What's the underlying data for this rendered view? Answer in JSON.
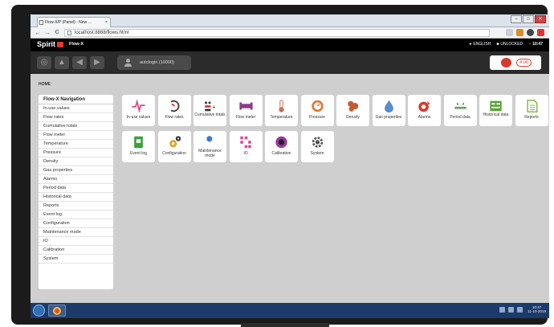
{
  "browser": {
    "tab_title": "Flow-X/P (Panel) - New …",
    "tab_close": "×",
    "url": "localhost:8888/flows.html",
    "window_controls": [
      "–",
      "□",
      "✕"
    ],
    "nav": {
      "back": "←",
      "forward": "→",
      "reload": "C"
    },
    "toolbar_icons": [
      "bookmark-star-icon",
      "extension-icon",
      "chrome-icon",
      "settings-menu-icon"
    ]
  },
  "app": {
    "logo": "Spirit",
    "name": "Flow-X",
    "status": [
      {
        "icon": "chat-icon",
        "glyph": "●",
        "label": "ENGLISH"
      },
      {
        "icon": "unlock-icon",
        "glyph": "■",
        "label": "UNLOCKED"
      },
      {
        "icon": "clock-icon",
        "glyph": "◔",
        "label": "10:47"
      }
    ]
  },
  "controls": {
    "buttons": [
      {
        "name": "globe-button",
        "glyph": "◎"
      },
      {
        "name": "home-button",
        "glyph": "▲"
      },
      {
        "name": "back-button",
        "glyph": "◀"
      },
      {
        "name": "forward-button",
        "glyph": "▶"
      }
    ],
    "login": "autologin (10000)",
    "alarm_count": "4 (4)"
  },
  "breadcrumb": "HOME",
  "sidebar": {
    "title": "Flow-X Navigation",
    "items": [
      "In-use values",
      "Flow rates",
      "Cumulative totals",
      "Flow meter",
      "Temperature",
      "Pressure",
      "Density",
      "Gas properties",
      "Alarms",
      "Period data",
      "Historical data",
      "Reports",
      "Event log",
      "Configuration",
      "Maintenance mode",
      "IO",
      "Calibration",
      "System"
    ]
  },
  "tiles": [
    {
      "label": "In-use values",
      "icon": "pulse-icon",
      "color": "#d94b8a"
    },
    {
      "label": "Flow rates",
      "icon": "gauge-icon",
      "color": "#4a3a30"
    },
    {
      "label": "Cumulative totals",
      "icon": "totals-icon",
      "color": "#333333"
    },
    {
      "label": "Flow meter",
      "icon": "pipe-icon",
      "color": "#8a3a8a"
    },
    {
      "label": "Temperature",
      "icon": "thermometer-icon",
      "color": "#c87050"
    },
    {
      "label": "Pressure",
      "icon": "pressure-gauge-icon",
      "color": "#e07a3a"
    },
    {
      "label": "Density",
      "icon": "density-icon",
      "color": "#c85a30"
    },
    {
      "label": "Gas properties",
      "icon": "droplet-icon",
      "color": "#5a8ad0"
    },
    {
      "label": "Alarms",
      "icon": "alarm-icon",
      "color": "#d63b2f"
    },
    {
      "label": "Period data",
      "icon": "period-icon",
      "color": "#3a8a3a"
    },
    {
      "label": "Historical data",
      "icon": "history-icon",
      "color": "#5aa23a"
    },
    {
      "label": "Reports",
      "icon": "report-icon",
      "color": "#7ab13a"
    },
    {
      "label": "Event log",
      "icon": "eventlog-icon",
      "color": "#3aa33a"
    },
    {
      "label": "Configuration",
      "icon": "gears-icon",
      "color": "#e0a020"
    },
    {
      "label": "Maintenance mode",
      "icon": "wrench-icon",
      "color": "#3a7ad0"
    },
    {
      "label": "IO",
      "icon": "io-icon",
      "color": "#d94ba0"
    },
    {
      "label": "Calibration",
      "icon": "calibration-icon",
      "color": "#9a3aa0"
    },
    {
      "label": "System",
      "icon": "system-gear-icon",
      "color": "#555555"
    }
  ],
  "taskbar": {
    "time": "10:47",
    "date": "11-10-2019"
  }
}
